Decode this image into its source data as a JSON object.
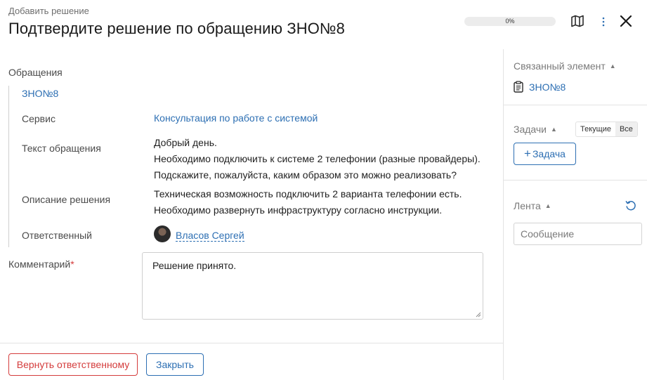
{
  "header": {
    "subtitle": "Добавить решение",
    "title": "Подтвердите решение по обращению ЗНО№8",
    "progress_text": "0%",
    "progress_value": 0,
    "icons": [
      "map-icon",
      "more-vertical-icon",
      "close-icon"
    ]
  },
  "main": {
    "section_label": "Обращения",
    "ticket": "ЗНО№8",
    "fields": {
      "service_label": "Сервис",
      "service_value": "Консультация по работе с системой",
      "text_label": "Текст обращения",
      "text_lines": [
        "Добрый день.",
        "Необходимо подключить к системе 2 телефонии (разные провайдеры).",
        "Подскажите, пожалуйста, каким образом это можно реализовать?"
      ],
      "solution_label": "Описание решения",
      "solution_lines": [
        "Техническая возможность подключить 2 варианта телефонии есть.",
        "Необходимо развернуть инфраструктуру согласно инструкции."
      ],
      "responsible_label": "Ответственный",
      "responsible_name": "Власов Сергей"
    },
    "comment": {
      "label": "Комментарий",
      "required_mark": "*",
      "value": "Решение принято."
    }
  },
  "footer": {
    "return_button": "Вернуть ответственному",
    "close_button": "Закрыть"
  },
  "sidebar": {
    "related_title": "Связанный элемент",
    "related_item": "ЗНО№8",
    "tasks_title": "Задачи",
    "tasks_filter": [
      "Текущие",
      "Все"
    ],
    "tasks_filter_selected": "Все",
    "add_task_label": "Задача",
    "feed_title": "Лента",
    "message_placeholder": "Сообщение"
  },
  "colors": {
    "accent": "#2d6fb3",
    "danger": "#d43c3c",
    "muted": "#7a7a7a",
    "border": "#e3e3e3"
  }
}
